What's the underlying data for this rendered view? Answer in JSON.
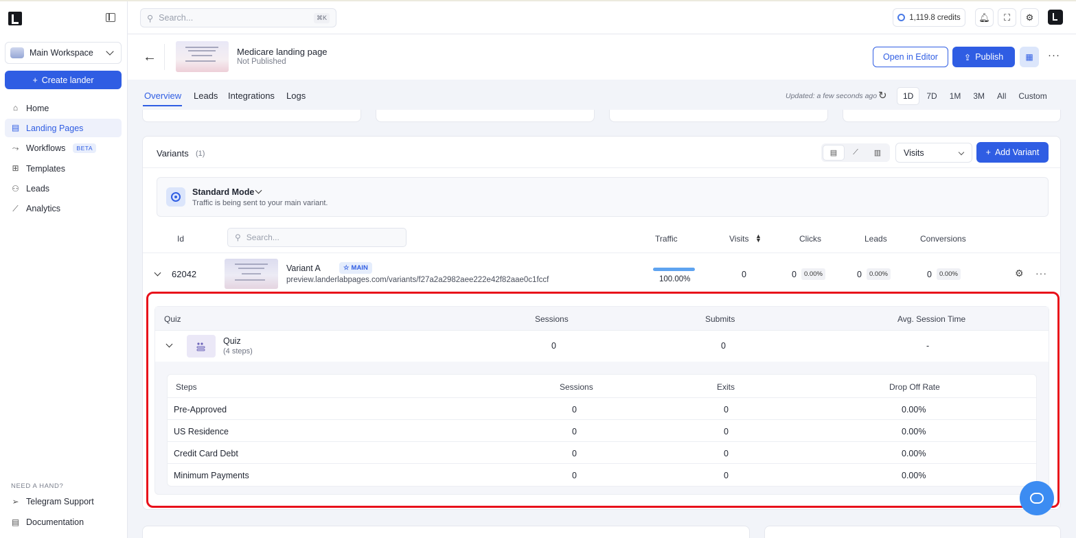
{
  "sidebar": {
    "workspace": "Main Workspace",
    "create_label": "Create lander",
    "nav": [
      {
        "label": "Home",
        "icon": "home-icon"
      },
      {
        "label": "Landing Pages",
        "icon": "document-icon",
        "active": true
      },
      {
        "label": "Workflows",
        "icon": "workflow-icon",
        "badge": "BETA"
      },
      {
        "label": "Templates",
        "icon": "grid-icon"
      },
      {
        "label": "Leads",
        "icon": "users-icon"
      },
      {
        "label": "Analytics",
        "icon": "chart-icon"
      }
    ],
    "help_title": "NEED A HAND?",
    "help": [
      {
        "label": "Telegram Support",
        "icon": "send-icon"
      },
      {
        "label": "Documentation",
        "icon": "document-icon"
      }
    ]
  },
  "header": {
    "search_placeholder": "Search...",
    "shortcut": "⌘K",
    "credits": "1,119.8 credits"
  },
  "page": {
    "title": "Medicare landing page",
    "status": "Not Published",
    "open_editor": "Open in Editor",
    "publish": "Publish"
  },
  "tabs": [
    "Overview",
    "Leads",
    "Integrations",
    "Logs"
  ],
  "updated": "Updated: a few seconds ago",
  "ranges": [
    "1D",
    "7D",
    "1M",
    "3M",
    "All",
    "Custom"
  ],
  "variants": {
    "title": "Variants",
    "count": "(1)",
    "metric": "Visits",
    "add_label": "Add Variant",
    "mode_title": "Standard Mode",
    "mode_sub": "Traffic is being sent to your main variant.",
    "columns": {
      "id": "Id",
      "search": "Search...",
      "traffic": "Traffic",
      "visits": "Visits",
      "clicks": "Clicks",
      "leads": "Leads",
      "conversions": "Conversions"
    },
    "row": {
      "id": "62042",
      "name": "Variant A",
      "badge": "MAIN",
      "url": "preview.landerlabpages.com/variants/f27a2a2982aee222e42f82aae0c1fccf",
      "traffic": "100.00%",
      "traffic_fraction": 1.0,
      "visits": "0",
      "clicks": "0",
      "clicks_pct": "0.00%",
      "leads": "0",
      "leads_pct": "0.00%",
      "conversions": "0",
      "conversions_pct": "0.00%"
    }
  },
  "quiz": {
    "columns": {
      "quiz": "Quiz",
      "sessions": "Sessions",
      "submits": "Submits",
      "avg": "Avg. Session Time"
    },
    "name": "Quiz",
    "steps_count": "(4 steps)",
    "sessions": "0",
    "submits": "0",
    "avg": "-",
    "step_columns": {
      "steps": "Steps",
      "sessions": "Sessions",
      "exits": "Exits",
      "drop": "Drop Off Rate"
    },
    "steps": [
      {
        "name": "Pre-Approved",
        "sessions": "0",
        "exits": "0",
        "drop": "0.00%"
      },
      {
        "name": "US Residence",
        "sessions": "0",
        "exits": "0",
        "drop": "0.00%"
      },
      {
        "name": "Credit Card Debt",
        "sessions": "0",
        "exits": "0",
        "drop": "0.00%"
      },
      {
        "name": "Minimum Payments",
        "sessions": "0",
        "exits": "0",
        "drop": "0.00%"
      }
    ]
  },
  "colors": {
    "accent": "#2f5de3",
    "highlight": "#e8101a"
  }
}
